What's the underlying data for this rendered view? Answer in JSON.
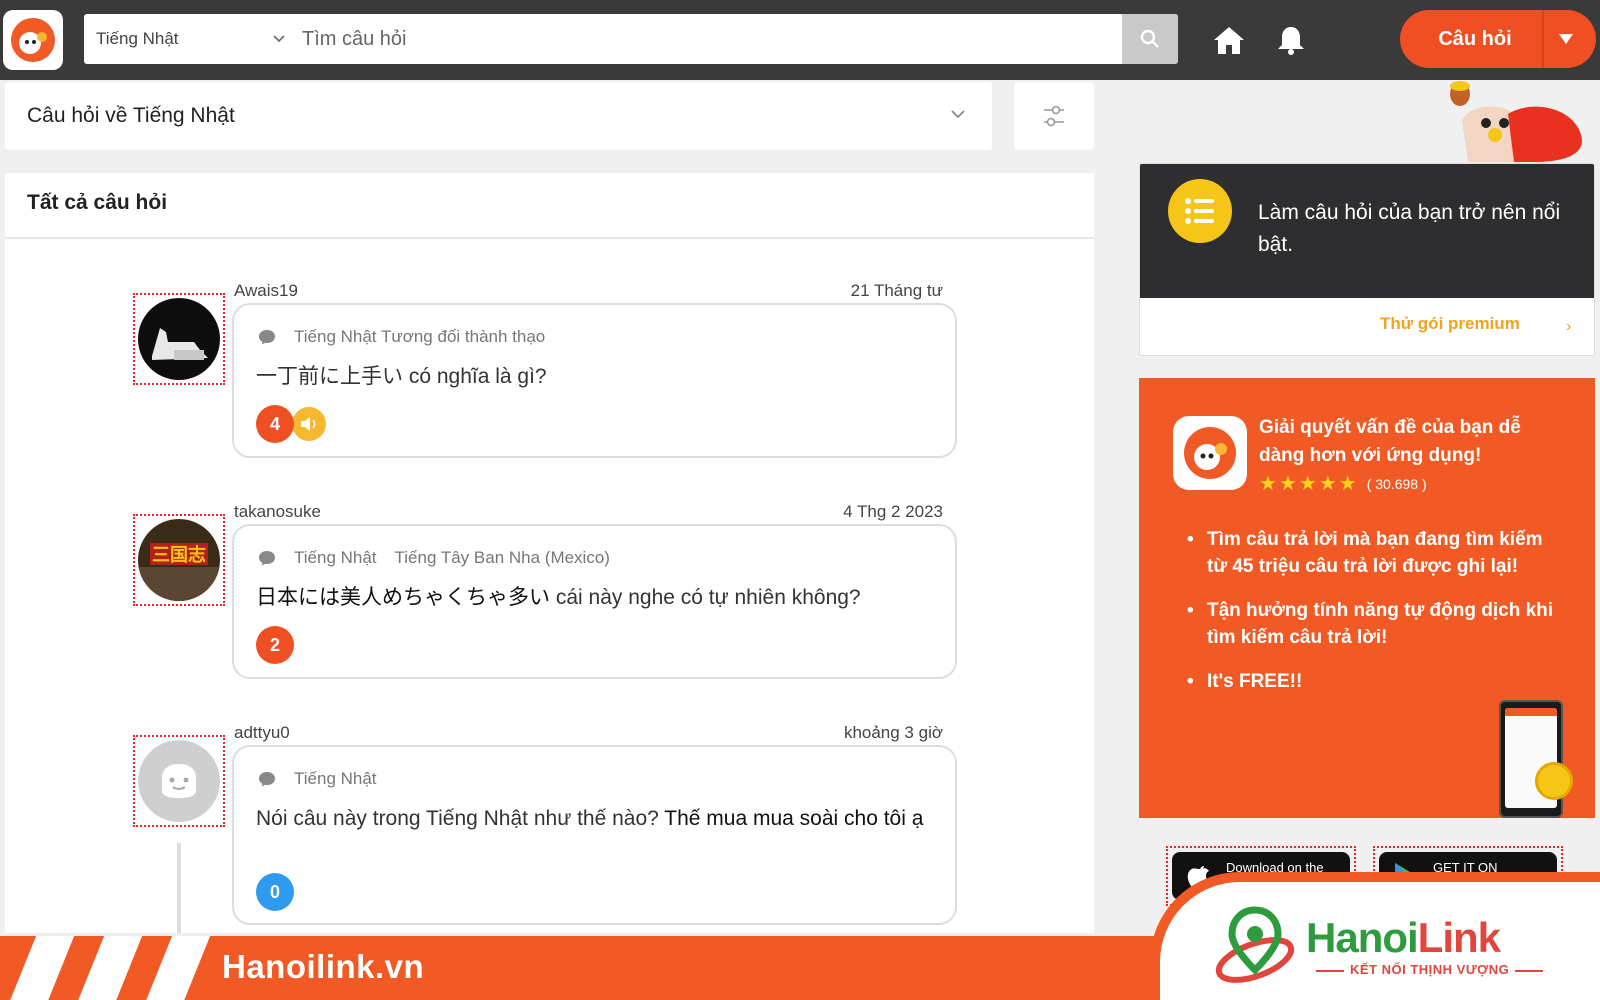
{
  "header": {
    "language_select": "Tiếng Nhật",
    "search_placeholder": "Tìm câu hỏi",
    "ask_button": "Câu hỏi"
  },
  "filter": {
    "label": "Câu hỏi về Tiếng Nhật"
  },
  "feed": {
    "title": "Tất cả câu hỏi",
    "questions": [
      {
        "user": "Awais19",
        "date": "21 Tháng tư",
        "tags": [
          "Tiếng Nhật Tương đối thành thạo"
        ],
        "text_jp": "一丁前に上手い",
        "text_vi": " có nghĩa là gì?",
        "answers": "4",
        "has_audio": true
      },
      {
        "user": "takanosuke",
        "date": "4 Thg 2 2023",
        "tags": [
          "Tiếng Nhật",
          "Tiếng Tây Ban Nha (Mexico)"
        ],
        "text_jp": "日本には美人めちゃくちゃ多い",
        "text_vi": " cái này nghe có tự nhiên không?",
        "answers": "2",
        "has_audio": false
      },
      {
        "user": "adttyu0",
        "date": "khoảng 3 giờ",
        "tags": [
          "Tiếng Nhật"
        ],
        "text_prefix": "Nói câu này trong Tiếng Nhật như thế nào? ",
        "text_quote": "Thế mua mua soài cho tôi ạ",
        "answers": "0",
        "has_audio": false
      }
    ]
  },
  "promo": {
    "text": "Làm câu hỏi của bạn trở nên nổi bật.",
    "link": "Thử gói premium"
  },
  "app_card": {
    "title": "Giải quyết vấn đề của bạn dễ dàng hơn với ứng dụng!",
    "rating_count": "( 30.698 )",
    "bullets": [
      "Tìm câu trả lời mà bạn đang tìm kiếm từ 45 triệu câu trả lời được ghi lại!",
      "Tận hưởng tính năng tự động dịch khi tìm kiếm câu trả lời!",
      "It's FREE!!"
    ]
  },
  "stores": {
    "apple": "Download on the",
    "google": "GET IT ON"
  },
  "banner": {
    "site": "Hanoilink.vn",
    "brand_part1": "Hanoi",
    "brand_part2": "Link",
    "brand_tagline": "KẾT NỐI THỊNH VƯỢNG"
  },
  "colors": {
    "accent": "#f15a24",
    "badge_orange": "#f04e23",
    "badge_blue": "#2f9bf0",
    "audio_yellow": "#f7b731",
    "premium_gold": "#f3a21a"
  }
}
